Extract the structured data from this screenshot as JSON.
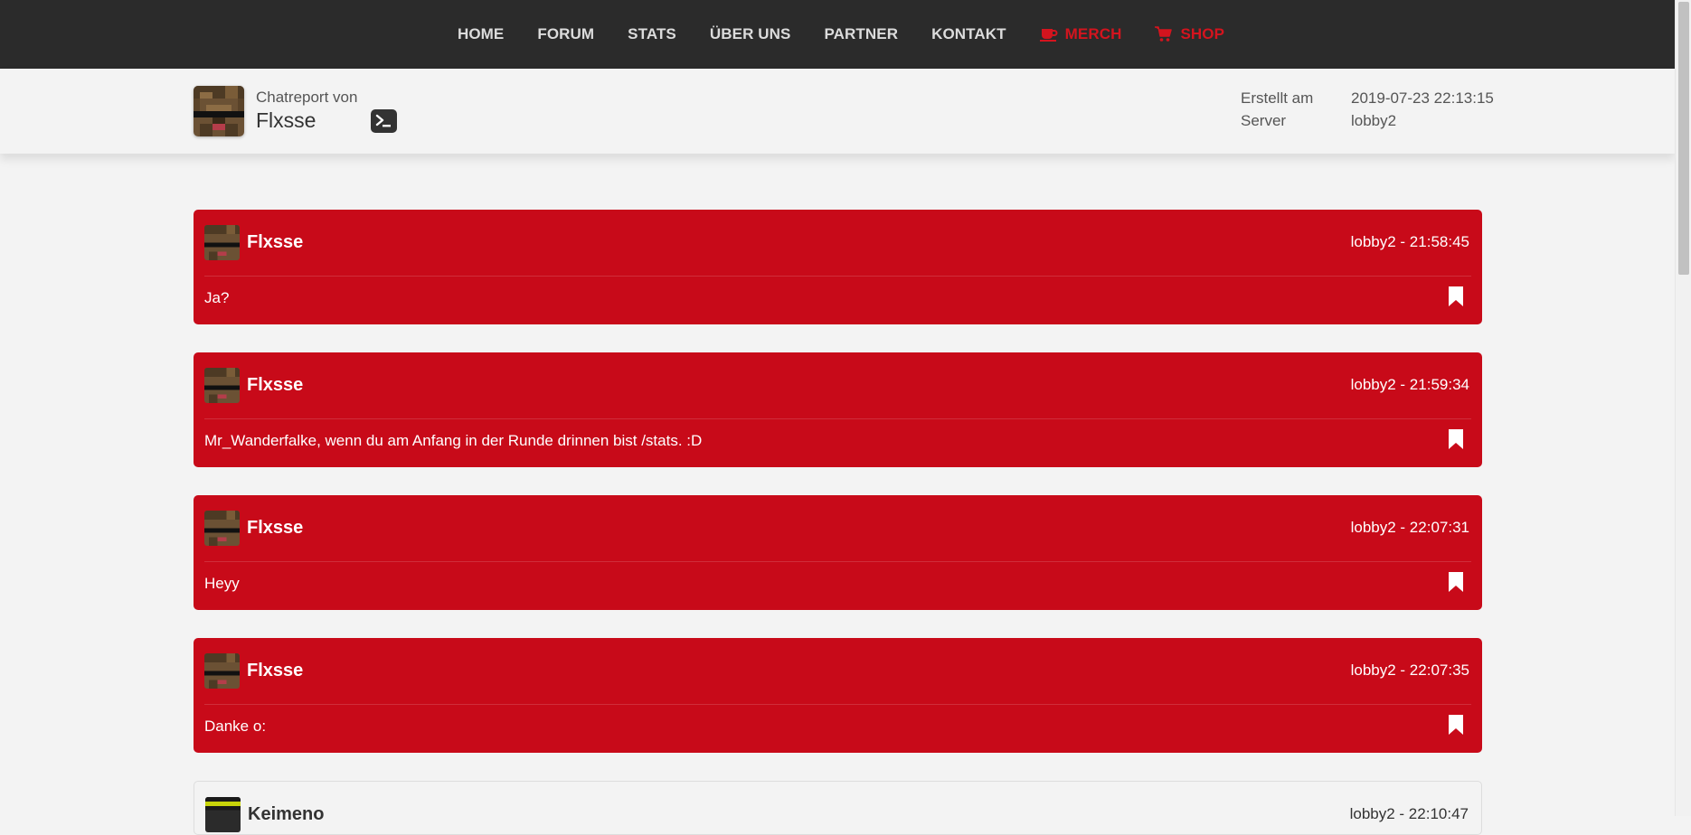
{
  "nav": {
    "items": [
      {
        "label": "HOME"
      },
      {
        "label": "FORUM"
      },
      {
        "label": "STATS"
      },
      {
        "label": "ÜBER UNS"
      },
      {
        "label": "PARTNER"
      },
      {
        "label": "KONTAKT"
      },
      {
        "label": "MERCH",
        "icon": "coffee-cup-icon"
      },
      {
        "label": "SHOP",
        "icon": "shopping-cart-icon"
      }
    ],
    "accent_color": "#d4141e"
  },
  "header": {
    "subtitle": "Chatreport von",
    "name": "Flxsse",
    "terminal_icon": "terminal-icon",
    "meta": [
      {
        "label": "Erstellt am",
        "value": "2019-07-23 22:13:15"
      },
      {
        "label": "Server",
        "value": "lobby2"
      }
    ]
  },
  "messages": [
    {
      "user": "Flxsse",
      "time": "lobby2 - 21:58:45",
      "text": "Ja?",
      "reported": true
    },
    {
      "user": "Flxsse",
      "time": "lobby2 - 21:59:34",
      "text": "Mr_Wanderfalke, wenn du am Anfang in der Runde drinnen bist /stats. :D",
      "reported": true
    },
    {
      "user": "Flxsse",
      "time": "lobby2 - 22:07:31",
      "text": "Heyy",
      "reported": true
    },
    {
      "user": "Flxsse",
      "time": "lobby2 - 22:07:35",
      "text": "Danke o:",
      "reported": true
    },
    {
      "user": "Keimeno",
      "time": "lobby2 - 22:10:47",
      "text": "",
      "reported": false
    }
  ],
  "colors": {
    "navbar_bg": "#2b2b2b",
    "reported_message_bg": "#c80a19",
    "page_bg": "#f3f3f3"
  }
}
